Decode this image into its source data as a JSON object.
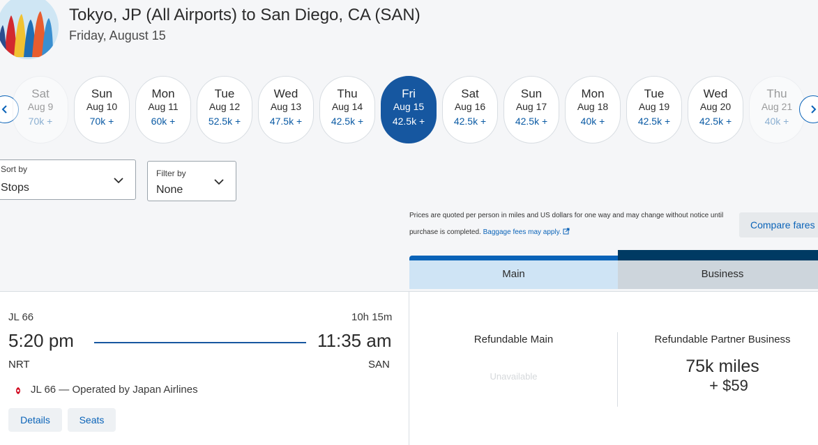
{
  "header": {
    "title": "Tokyo, JP (All Airports) to San Diego, CA (SAN)",
    "subtitle": "Friday, August 15"
  },
  "dates": [
    {
      "dow": "Sat",
      "dom": "Aug 9",
      "price": "70k +",
      "state": "faded"
    },
    {
      "dow": "Sun",
      "dom": "Aug 10",
      "price": "70k +",
      "state": "normal"
    },
    {
      "dow": "Mon",
      "dom": "Aug 11",
      "price": "60k +",
      "state": "normal"
    },
    {
      "dow": "Tue",
      "dom": "Aug 12",
      "price": "52.5k +",
      "state": "normal"
    },
    {
      "dow": "Wed",
      "dom": "Aug 13",
      "price": "47.5k +",
      "state": "normal"
    },
    {
      "dow": "Thu",
      "dom": "Aug 14",
      "price": "42.5k +",
      "state": "normal"
    },
    {
      "dow": "Fri",
      "dom": "Aug 15",
      "price": "42.5k +",
      "state": "selected"
    },
    {
      "dow": "Sat",
      "dom": "Aug 16",
      "price": "42.5k +",
      "state": "normal"
    },
    {
      "dow": "Sun",
      "dom": "Aug 17",
      "price": "42.5k +",
      "state": "normal"
    },
    {
      "dow": "Mon",
      "dom": "Aug 18",
      "price": "40k +",
      "state": "normal"
    },
    {
      "dow": "Tue",
      "dom": "Aug 19",
      "price": "42.5k +",
      "state": "normal"
    },
    {
      "dow": "Wed",
      "dom": "Aug 20",
      "price": "42.5k +",
      "state": "normal"
    },
    {
      "dow": "Thu",
      "dom": "Aug 21",
      "price": "40k +",
      "state": "faded"
    }
  ],
  "sort": {
    "label": "Sort by",
    "value": "Stops"
  },
  "filter": {
    "label": "Filter by",
    "value": "None"
  },
  "disclaimer": {
    "text": "Prices are quoted per person in miles and US dollars for one way and may change without notice until purchase is completed.",
    "link": "Baggage fees may apply."
  },
  "compare_label": "Compare fares",
  "tabs": {
    "main": "Main",
    "business": "Business"
  },
  "flight": {
    "number": "JL 66",
    "duration": "10h 15m",
    "depart_time": "5:20 pm",
    "arrive_time": "11:35 am",
    "depart_code": "NRT",
    "arrive_code": "SAN",
    "operated_by": "JL 66 — Operated by Japan Airlines",
    "details_label": "Details",
    "seats_label": "Seats"
  },
  "fares": {
    "main_header": "Refundable Main",
    "main_status": "Unavailable",
    "business_header": "Refundable Partner Business",
    "business_miles": "75k miles",
    "business_fee": "+ $59"
  },
  "colors": {
    "accent": "#0a63b8",
    "selected_date": "#1657a0",
    "business_tab_bar": "#003a63",
    "main_tab_bg": "#cfe4f5",
    "business_tab_bg": "#cdd5dc"
  }
}
